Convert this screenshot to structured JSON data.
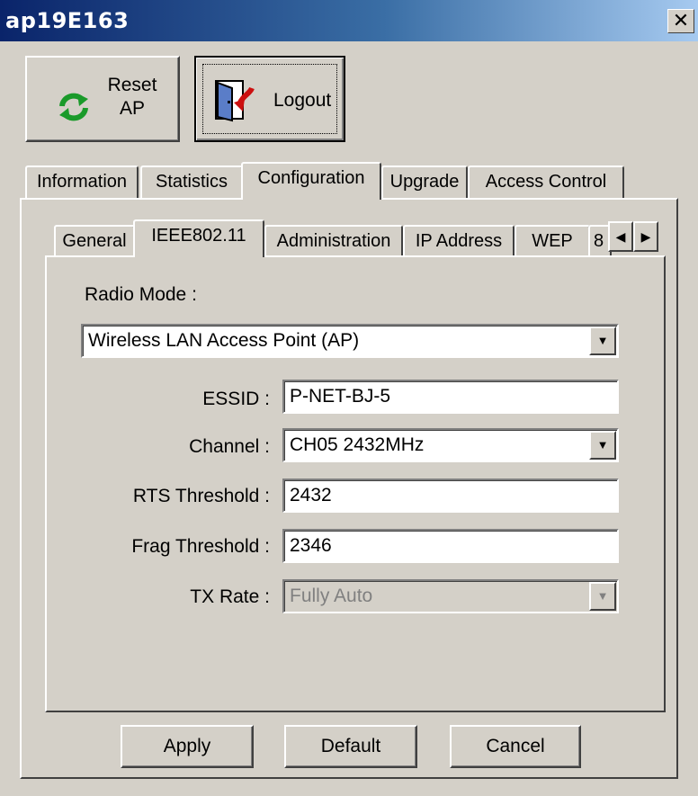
{
  "window": {
    "title": "ap19E163",
    "close_glyph": "✕"
  },
  "toolbar": {
    "reset_label_line1": "Reset",
    "reset_label_line2": "AP",
    "reset_icon": "refresh-arrows-icon",
    "logout_label": "Logout",
    "logout_icon": "door-exit-icon"
  },
  "main_tabs": [
    "Information",
    "Statistics",
    "Configuration",
    "Upgrade",
    "Access Control"
  ],
  "main_tabs_active": "Configuration",
  "config_tabs": [
    "General",
    "IEEE802.11",
    "Administration",
    "IP Address",
    "WEP",
    "8"
  ],
  "config_tabs_active": "IEEE802.11",
  "form": {
    "radio_mode_label": "Radio Mode :",
    "radio_mode_value": "Wireless LAN Access Point (AP)",
    "essid_label": "ESSID :",
    "essid_value": "P-NET-BJ-5",
    "channel_label": "Channel :",
    "channel_value": "CH05 2432MHz",
    "rts_label": "RTS Threshold :",
    "rts_value": "2432",
    "frag_label": "Frag Threshold :",
    "frag_value": "2346",
    "txrate_label": "TX Rate :",
    "txrate_value": "Fully Auto"
  },
  "buttons": {
    "apply": "Apply",
    "default": "Default",
    "cancel": "Cancel"
  },
  "colors": {
    "face": "#d4d0c8",
    "title_start": "#0a246a",
    "title_end": "#a6caf0",
    "refresh_green": "#1a9a2a",
    "door_red": "#cc1010"
  }
}
